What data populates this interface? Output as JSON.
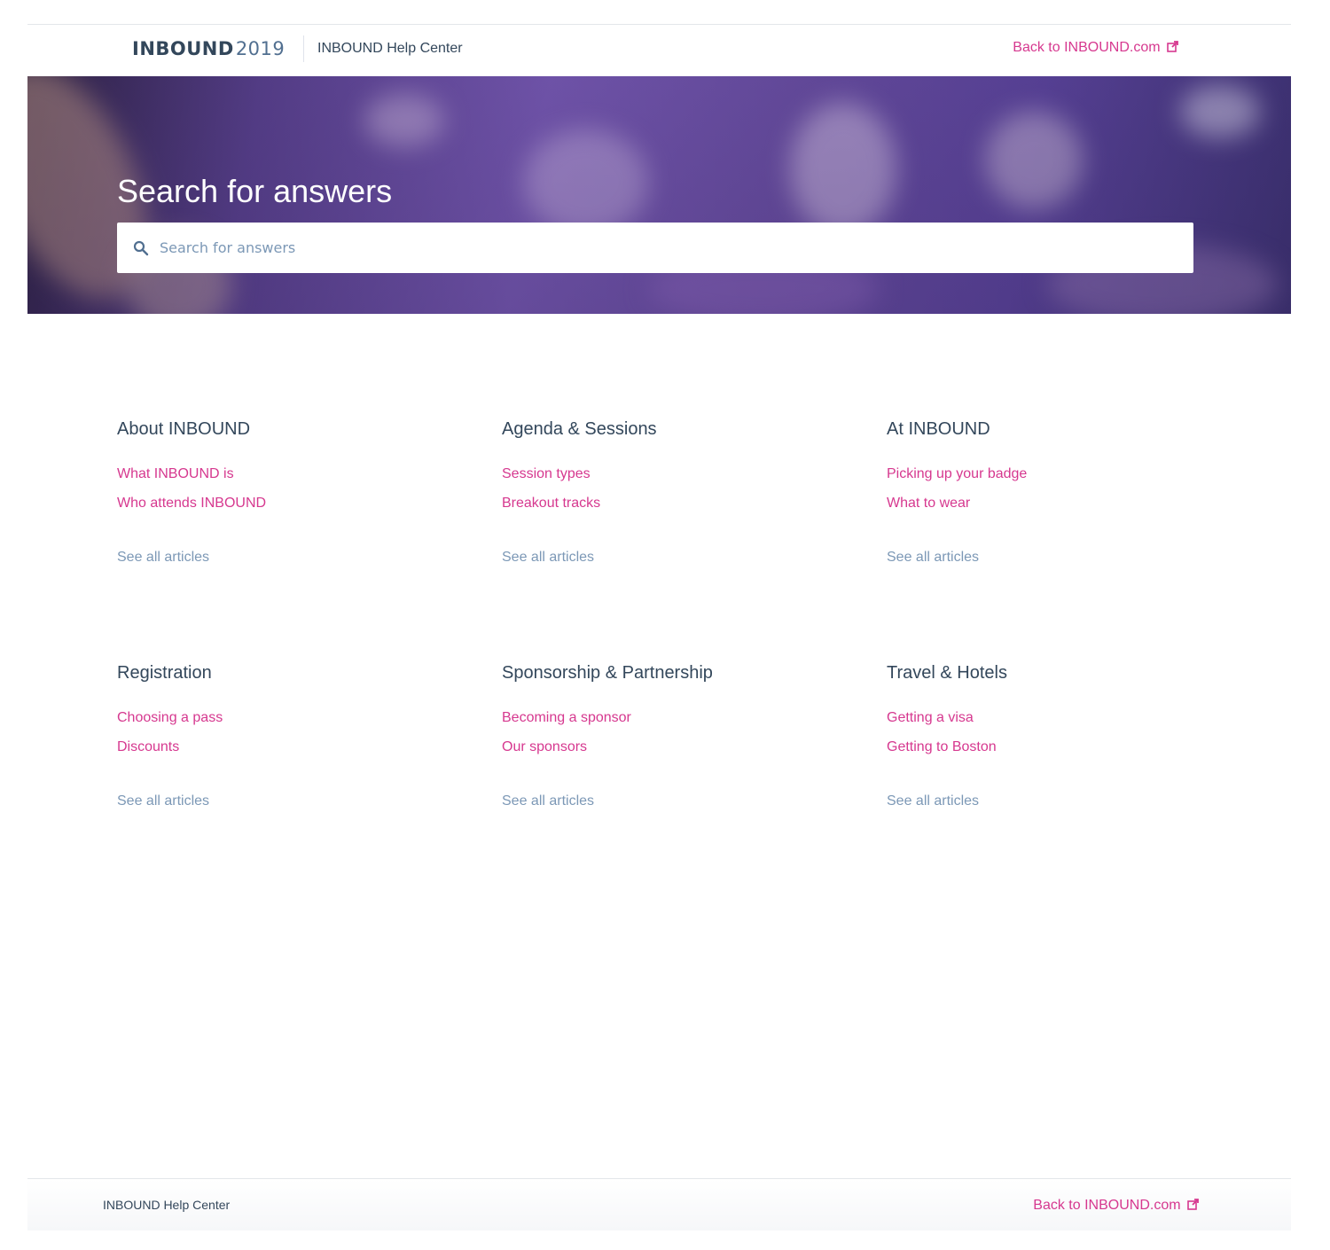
{
  "header": {
    "logo_brand": "INBOUND",
    "logo_year": "2019",
    "title": "INBOUND Help Center",
    "back_link": "Back to INBOUND.com"
  },
  "hero": {
    "title": "Search for answers",
    "search_placeholder": "Search for answers",
    "search_value": ""
  },
  "categories": [
    {
      "title": "About INBOUND",
      "links": [
        "What INBOUND is",
        "Who attends INBOUND"
      ],
      "see_all": "See all articles"
    },
    {
      "title": "Agenda & Sessions",
      "links": [
        "Session types",
        "Breakout tracks"
      ],
      "see_all": "See all articles"
    },
    {
      "title": "At INBOUND",
      "links": [
        "Picking up your badge",
        "What to wear"
      ],
      "see_all": "See all articles"
    },
    {
      "title": "Registration",
      "links": [
        "Choosing a pass",
        "Discounts"
      ],
      "see_all": "See all articles"
    },
    {
      "title": "Sponsorship & Partnership",
      "links": [
        "Becoming a sponsor",
        "Our sponsors"
      ],
      "see_all": "See all articles"
    },
    {
      "title": "Travel & Hotels",
      "links": [
        "Getting a visa",
        "Getting to Boston"
      ],
      "see_all": "See all articles"
    }
  ],
  "footer": {
    "title": "INBOUND Help Center",
    "back_link": "Back to INBOUND.com"
  },
  "colors": {
    "accent_link": "#d6388f",
    "heading_text": "#33475b",
    "muted_text": "#7c98b6",
    "hero_purple": "#6b50a6"
  },
  "icons": {
    "search": "search-icon",
    "external": "external-link-icon"
  }
}
